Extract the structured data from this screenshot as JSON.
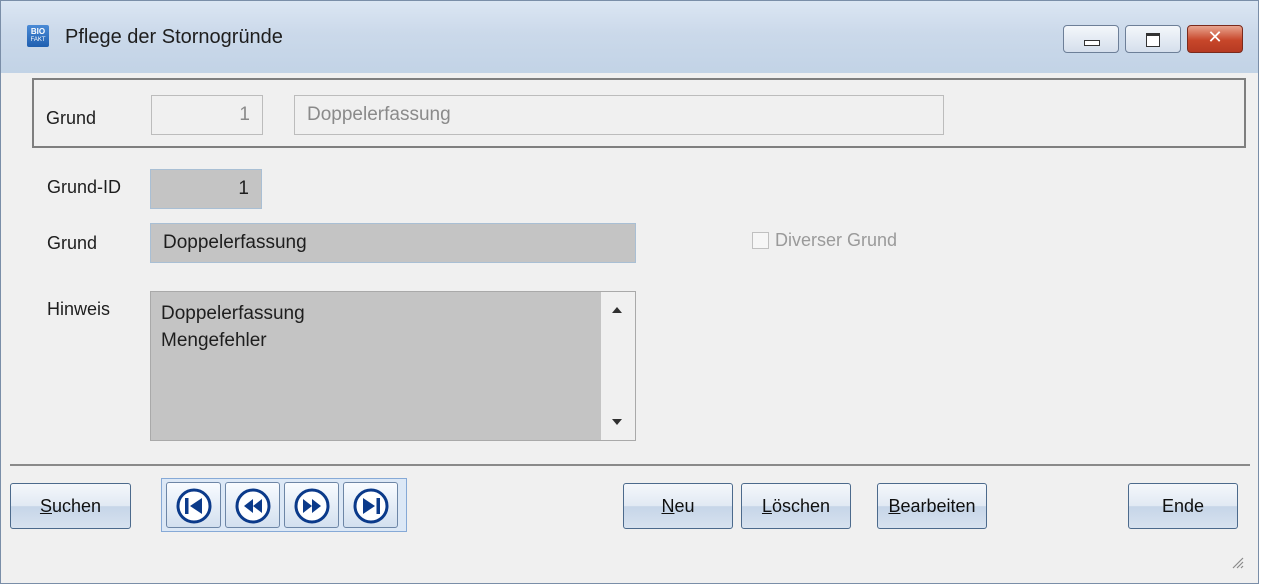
{
  "window": {
    "title": "Pflege der Stornogründe",
    "icon_text_top": "BIO",
    "icon_text_bottom": "FAKT",
    "close_symbol": "✕"
  },
  "search": {
    "label": "Grund",
    "id_value": "1",
    "text_value": "Doppelerfassung"
  },
  "form": {
    "grund_id_label": "Grund-ID",
    "grund_id_value": "1",
    "grund_label": "Grund",
    "grund_value": "Doppelerfassung",
    "diverser_label": "Diverser Grund",
    "diverser_checked": false,
    "hinweis_label": "Hinweis",
    "hinweis_lines": [
      "Doppelerfassung",
      "Mengefehler"
    ]
  },
  "buttons": {
    "suchen": {
      "mnemonic": "S",
      "rest": "uchen"
    },
    "neu": {
      "mnemonic": "N",
      "rest": "eu"
    },
    "loeschen": {
      "mnemonic": "L",
      "rest": "öschen"
    },
    "bearbeiten": {
      "mnemonic": "B",
      "rest": "earbeiten"
    },
    "ende": "Ende"
  },
  "navigation": {
    "icons": [
      "first-record-icon",
      "previous-record-icon",
      "next-record-icon",
      "last-record-icon"
    ]
  },
  "colors": {
    "accent": "#1a5fb4",
    "field_gray": "#c4c4c4",
    "close_red": "#c7462a"
  }
}
